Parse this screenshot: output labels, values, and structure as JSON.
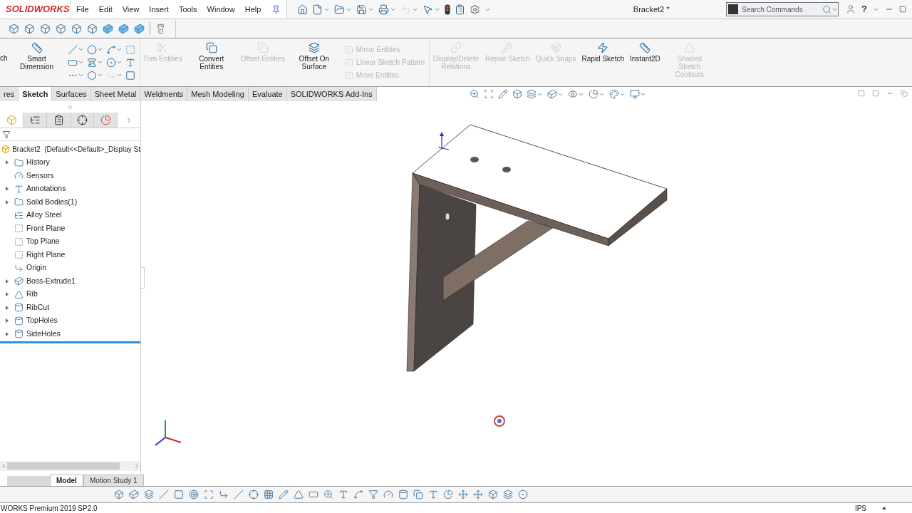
{
  "app": {
    "logo": "SOLIDWORKS",
    "menu": [
      "File",
      "Edit",
      "View",
      "Insert",
      "Tools",
      "Window",
      "Help"
    ],
    "document_title": "Bracket2 *",
    "help": "?",
    "search": {
      "placeholder": "Search Commands"
    }
  },
  "command_manager": {
    "cut_command": "ch",
    "commands": [
      {
        "kind": "large",
        "label": "Smart Dimension",
        "disabled": false
      },
      {
        "kind": "tools"
      },
      {
        "kind": "large",
        "label": "Trim Entities",
        "disabled": true
      },
      {
        "kind": "large",
        "label": "Convert Entities",
        "disabled": false
      },
      {
        "kind": "large",
        "label": "Offset Entities",
        "disabled": true
      },
      {
        "kind": "large",
        "label": "Offset On Surface",
        "disabled": false
      },
      {
        "kind": "list",
        "items": [
          {
            "label": "Mirror Entities",
            "disabled": true
          },
          {
            "label": "Linear Sketch Pattern",
            "disabled": true
          },
          {
            "label": "Move Entities",
            "disabled": true
          }
        ]
      },
      {
        "kind": "large",
        "label": "Display/Delete Relations",
        "disabled": true
      },
      {
        "kind": "large",
        "label": "Repair Sketch",
        "disabled": true
      },
      {
        "kind": "large",
        "label": "Quick Snaps",
        "disabled": true
      },
      {
        "kind": "large",
        "label": "Rapid Sketch",
        "disabled": false
      },
      {
        "kind": "large",
        "label": "Instant2D",
        "disabled": false
      },
      {
        "kind": "large",
        "label": "Shaded Sketch Contours",
        "disabled": true
      }
    ]
  },
  "command_tabs": [
    {
      "label": "res",
      "selected": false
    },
    {
      "label": "Sketch",
      "selected": true
    },
    {
      "label": "Surfaces",
      "selected": false
    },
    {
      "label": "Sheet Metal",
      "selected": false
    },
    {
      "label": "Weldments",
      "selected": false
    },
    {
      "label": "Mesh Modeling",
      "selected": false
    },
    {
      "label": "Evaluate",
      "selected": false
    },
    {
      "label": "SOLIDWORKS Add-Ins",
      "selected": false
    }
  ],
  "feature_manager": {
    "tabs": [
      {
        "kind": "features",
        "selected": true
      },
      {
        "kind": "properties",
        "selected": false
      },
      {
        "kind": "configurations",
        "selected": false
      },
      {
        "kind": "dimxpert",
        "selected": false
      },
      {
        "kind": "display",
        "selected": false
      }
    ],
    "root": "Bracket2  (Default<<Default>_Display St",
    "items": [
      {
        "label": "History",
        "kind": "folder",
        "collapsed": true
      },
      {
        "label": "Sensors",
        "kind": "sensor",
        "collapsed": false
      },
      {
        "label": "Annotations",
        "kind": "annotation",
        "collapsed": true
      },
      {
        "label": "Solid Bodies(1)",
        "kind": "bodies",
        "collapsed": true
      },
      {
        "label": "Alloy Steel",
        "kind": "material",
        "collapsed": false
      },
      {
        "label": "Front Plane",
        "kind": "plane",
        "collapsed": false
      },
      {
        "label": "Top Plane",
        "kind": "plane",
        "collapsed": false
      },
      {
        "label": "Right Plane",
        "kind": "plane",
        "collapsed": false
      },
      {
        "label": "Origin",
        "kind": "origin",
        "collapsed": false
      },
      {
        "label": "Boss-Extrude1",
        "kind": "feature",
        "collapsed": true
      },
      {
        "label": "Rib",
        "kind": "rib",
        "collapsed": true
      },
      {
        "label": "RibCut",
        "kind": "cut",
        "collapsed": true
      },
      {
        "label": "TopHoles",
        "kind": "cut",
        "collapsed": true
      },
      {
        "label": "SideHoles",
        "kind": "cut",
        "collapsed": true
      }
    ]
  },
  "bottom_tabs": [
    {
      "label": "Model",
      "selected": true
    },
    {
      "label": "Motion Study 1",
      "selected": false
    }
  ],
  "status_bar": {
    "product": "WORKS Premium 2019 SP2.0",
    "units": "IPS"
  }
}
